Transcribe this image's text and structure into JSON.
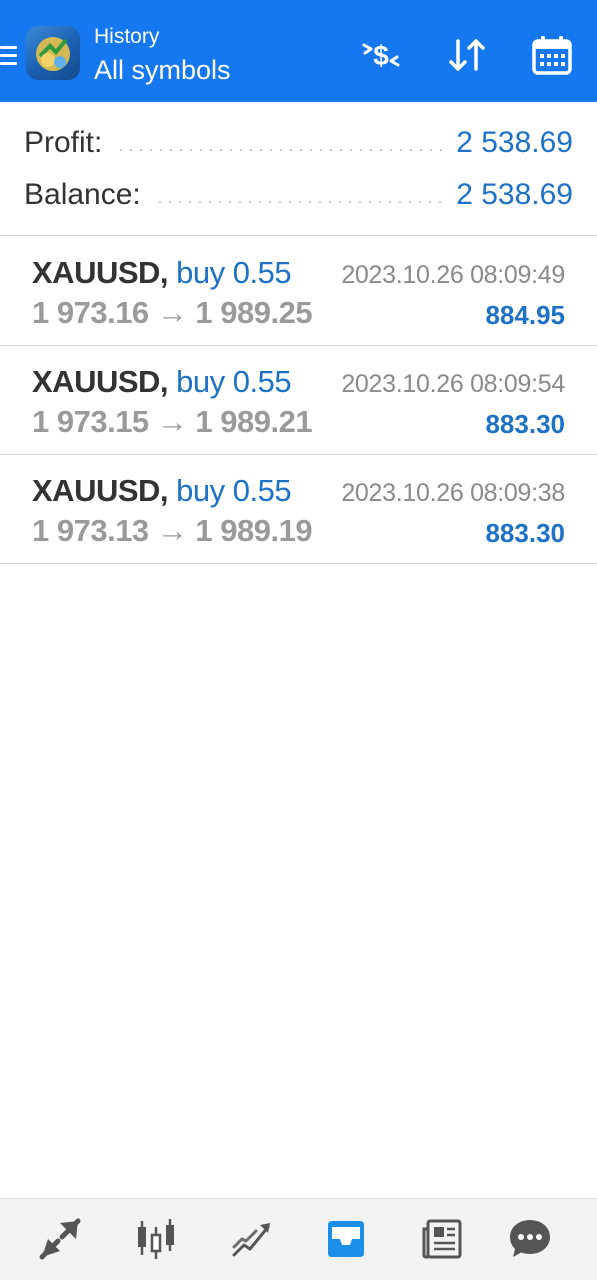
{
  "header": {
    "title": "History",
    "subtitle": "All symbols",
    "actions": [
      {
        "name": "deposit-filter",
        "icon": "dollar-transfer-icon"
      },
      {
        "name": "sort",
        "icon": "sort-arrows-icon"
      },
      {
        "name": "period",
        "icon": "calendar-icon"
      }
    ]
  },
  "summary": {
    "profit_label": "Profit:",
    "profit_value": "2 538.69",
    "balance_label": "Balance:",
    "balance_value": "2 538.69"
  },
  "deals": [
    {
      "symbol": "XAUUSD,",
      "direction": "buy 0.55",
      "open_price": "1 973.16",
      "arrow": "→",
      "close_price": "1 989.25",
      "time": "2023.10.26 08:09:49",
      "profit": "884.95"
    },
    {
      "symbol": "XAUUSD,",
      "direction": "buy 0.55",
      "open_price": "1 973.15",
      "arrow": "→",
      "close_price": "1 989.21",
      "time": "2023.10.26 08:09:54",
      "profit": "883.30"
    },
    {
      "symbol": "XAUUSD,",
      "direction": "buy 0.55",
      "open_price": "1 973.13",
      "arrow": "→",
      "close_price": "1 989.19",
      "time": "2023.10.26 08:09:38",
      "profit": "883.30"
    }
  ],
  "bottom_nav": [
    {
      "name": "quotes",
      "icon": "quotes-arrows-icon",
      "active": false
    },
    {
      "name": "chart",
      "icon": "candlestick-icon",
      "active": false
    },
    {
      "name": "trade",
      "icon": "trend-lines-icon",
      "active": false
    },
    {
      "name": "history",
      "icon": "inbox-icon",
      "active": true
    },
    {
      "name": "news",
      "icon": "newspaper-icon",
      "active": false
    },
    {
      "name": "messages",
      "icon": "chat-bubble-icon",
      "active": false
    }
  ],
  "colors": {
    "appbar": "#1578f0",
    "accent_blue": "#1d72c8",
    "active_nav": "#1a8ee8",
    "inactive_nav": "#555555"
  }
}
